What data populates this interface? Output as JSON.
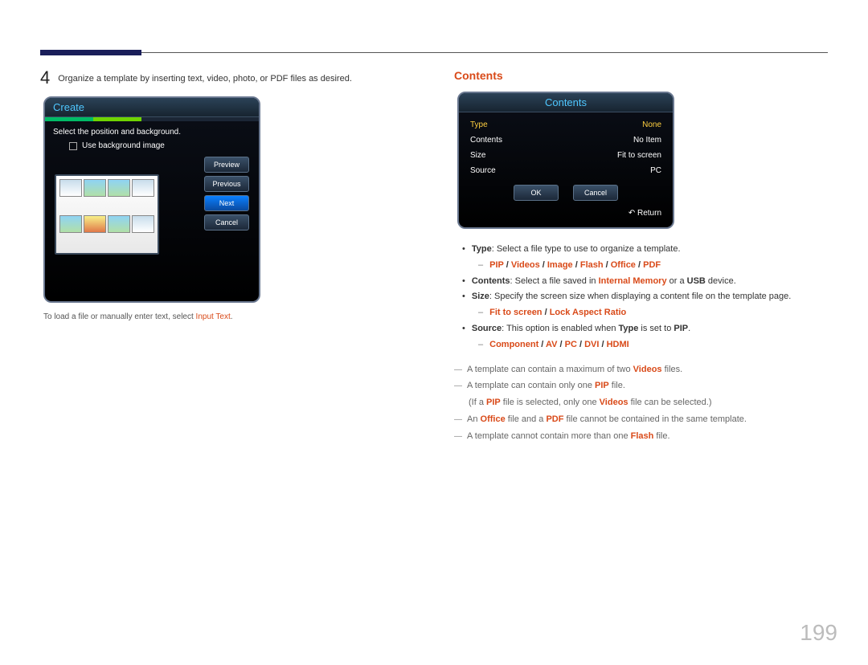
{
  "step": {
    "number": "4",
    "text": "Organize a template by inserting text, video, photo, or PDF files as desired."
  },
  "createPanel": {
    "title": "Create",
    "subtitle": "Select the position and background.",
    "checkbox_label": "Use background image",
    "buttons": {
      "preview": "Preview",
      "previous": "Previous",
      "next": "Next",
      "cancel": "Cancel"
    }
  },
  "leftNote": {
    "pre": "To load a file or manually enter text, select ",
    "red": "Input Text",
    "post": "."
  },
  "contentsSection": {
    "heading": "Contents",
    "panelTitle": "Contents",
    "rows": {
      "type_k": "Type",
      "type_v": "None",
      "contents_k": "Contents",
      "contents_v": "No Item",
      "size_k": "Size",
      "size_v": "Fit to screen",
      "source_k": "Source",
      "source_v": "PC"
    },
    "buttons": {
      "ok": "OK",
      "cancel": "Cancel"
    },
    "returnIcon": "↶",
    "returnLabel": "Return"
  },
  "bullets": {
    "type": {
      "k": "Type",
      "desc": ": Select a file type to use to organize a template."
    },
    "type_opts": [
      "PIP",
      "Videos",
      "Image",
      "Flash",
      "Office",
      "PDF"
    ],
    "contents": {
      "k": "Contents",
      "a": ": Select a file saved in ",
      "mem": "Internal Memory",
      "b": " or a ",
      "usb": "USB",
      "c": " device."
    },
    "size": {
      "k": "Size",
      "desc": ": Specify the screen size when displaying a content file on the template page."
    },
    "size_opts": [
      "Fit to screen",
      "Lock Aspect Ratio"
    ],
    "source": {
      "k": "Source",
      "a": ": This option is enabled when ",
      "type": "Type",
      "b": " is set to ",
      "pip": "PIP",
      "c": "."
    },
    "source_opts": [
      "Component",
      "AV",
      "PC",
      "DVI",
      "HDMI"
    ]
  },
  "footnotes": {
    "a": {
      "pre": "A template can contain a maximum of two ",
      "b": "Videos",
      "post": " files."
    },
    "b": {
      "pre": "A template can contain only one ",
      "b": "PIP",
      "post": " file."
    },
    "b2": {
      "pre": "(If a ",
      "pip": "PIP",
      "mid": " file is selected, only one ",
      "vid": "Videos",
      "post": " file can be selected.)"
    },
    "c": {
      "pre": "An ",
      "off": "Office",
      "mid": " file and a ",
      "pdf": "PDF",
      "post": " file cannot be contained in the same template."
    },
    "d": {
      "pre": "A template cannot contain more than one ",
      "fl": "Flash",
      "post": " file."
    }
  },
  "pageNumber": "199"
}
